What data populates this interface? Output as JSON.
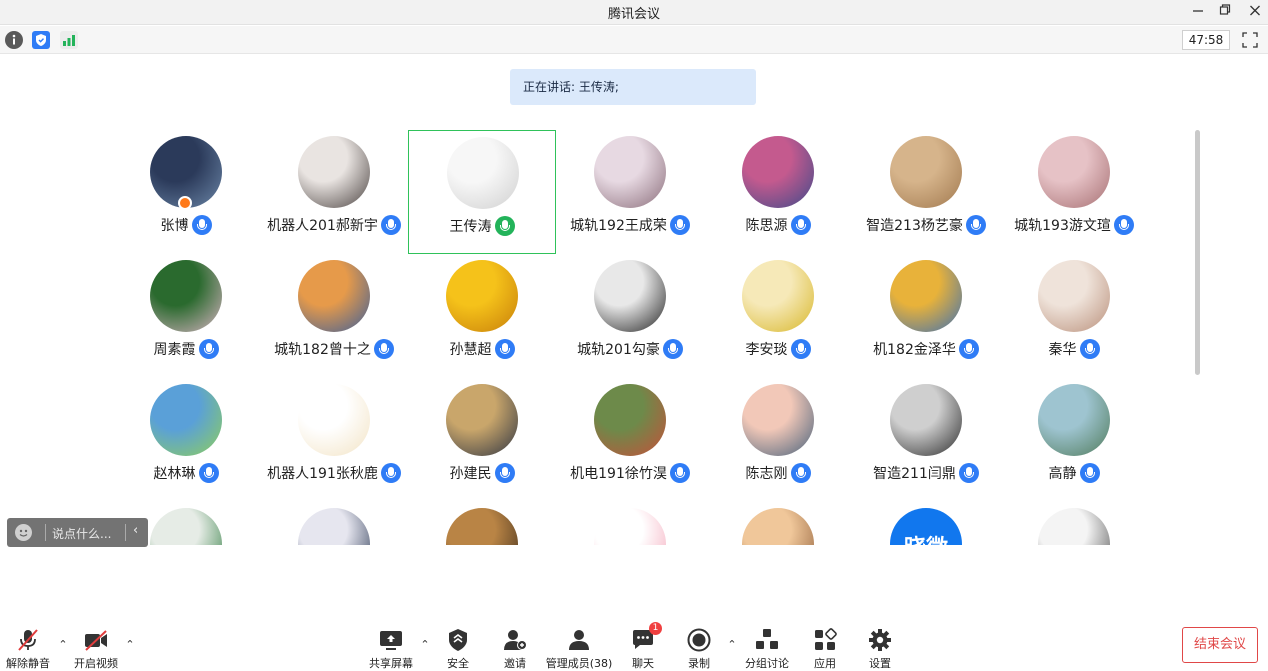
{
  "window": {
    "title": "腾讯会议"
  },
  "statusbar": {
    "timer": "47:58"
  },
  "speaking": {
    "text": "正在讲话: 王传涛;"
  },
  "participants": [
    {
      "name": "张博",
      "colors": [
        "#2b3a5a",
        "#6c87a8"
      ],
      "host": true
    },
    {
      "name": "机器人201郝新宇",
      "colors": [
        "#e9e4e1",
        "#4b4341"
      ]
    },
    {
      "name": "王传涛",
      "colors": [
        "#f7f7f7",
        "#cfcfcf"
      ],
      "speaking": true
    },
    {
      "name": "城轨192王成荣",
      "colors": [
        "#e7d9e2",
        "#8a6d7a"
      ]
    },
    {
      "name": "陈思源",
      "colors": [
        "#c45a8e",
        "#3d4a8a"
      ]
    },
    {
      "name": "智造213杨艺豪",
      "colors": [
        "#d6b48b",
        "#a0784e"
      ]
    },
    {
      "name": "城轨193游文瑄",
      "colors": [
        "#e6c2c6",
        "#a66f72"
      ]
    },
    {
      "name": "周素霞",
      "colors": [
        "#2a6a2e",
        "#d8b4c3"
      ]
    },
    {
      "name": "城轨182曾十之",
      "colors": [
        "#e69a4a",
        "#3b5e9a"
      ]
    },
    {
      "name": "孙慧超",
      "colors": [
        "#f5c21a",
        "#c77e0a"
      ]
    },
    {
      "name": "城轨201勾豪",
      "colors": [
        "#e8e8e8",
        "#222222"
      ]
    },
    {
      "name": "李安琰",
      "colors": [
        "#f6e9b8",
        "#d8b72a"
      ]
    },
    {
      "name": "机182金泽华",
      "colors": [
        "#e8b23a",
        "#3c6fb4"
      ]
    },
    {
      "name": "秦华",
      "colors": [
        "#efe3da",
        "#b98f7a"
      ]
    },
    {
      "name": "赵林琳",
      "colors": [
        "#5aa0d8",
        "#8fcf5a"
      ]
    },
    {
      "name": "机器人191张秋鹿",
      "colors": [
        "#ffffff",
        "#f2e3c4"
      ]
    },
    {
      "name": "孙建民",
      "colors": [
        "#c9a66b",
        "#2e3442"
      ]
    },
    {
      "name": "机电191徐竹淏",
      "colors": [
        "#6d8a4a",
        "#c6503a"
      ]
    },
    {
      "name": "陈志刚",
      "colors": [
        "#f2c8b8",
        "#46607a"
      ]
    },
    {
      "name": "智造211闫鼎",
      "colors": [
        "#cfcfcf",
        "#2b2b2b"
      ]
    },
    {
      "name": "高静",
      "colors": [
        "#9ec4d0",
        "#4f7a5a"
      ]
    },
    {
      "name": "",
      "colors": [
        "#e6ece6",
        "#2d7a3e"
      ]
    },
    {
      "name": "",
      "colors": [
        "#e6e6ef",
        "#24324e"
      ]
    },
    {
      "name": "",
      "colors": [
        "#b98445",
        "#3a2a1a"
      ]
    },
    {
      "name": "",
      "colors": [
        "#ffffff",
        "#f3a5b8"
      ]
    },
    {
      "name": "",
      "colors": [
        "#f0c79a",
        "#8b5a35"
      ]
    },
    {
      "name": "",
      "colors": [
        "#1177ee",
        "#1177ee"
      ],
      "text": "晓微"
    },
    {
      "name": "",
      "colors": [
        "#f4f4f4",
        "#4a4a4a"
      ]
    }
  ],
  "chat": {
    "placeholder": "说点什么..."
  },
  "toolbar": {
    "unmute": "解除静音",
    "start_video": "开启视频",
    "share_screen": "共享屏幕",
    "security": "安全",
    "invite": "邀请",
    "manage_members": "管理成员(38)",
    "chat": "聊天",
    "chat_badge": "1",
    "record": "录制",
    "breakout": "分组讨论",
    "apps": "应用",
    "settings": "设置",
    "end_meeting": "结束会议"
  }
}
